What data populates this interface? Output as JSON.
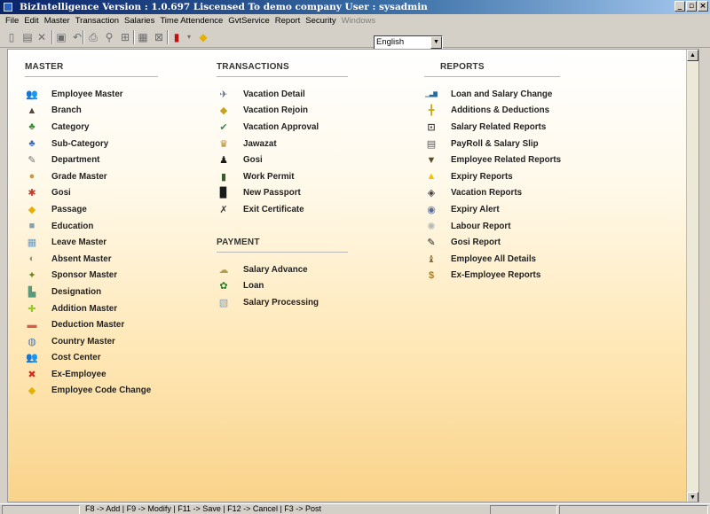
{
  "window": {
    "title": "BizIntelligence Version : 1.0.697   Liscensed To demo company  User : sysadmin",
    "buttons": {
      "minimize": "_",
      "restore": "▫",
      "close": "×"
    }
  },
  "menu": [
    {
      "label": "File",
      "enabled": true
    },
    {
      "label": "Edit",
      "enabled": true
    },
    {
      "label": "Master",
      "enabled": true
    },
    {
      "label": "Transaction",
      "enabled": true
    },
    {
      "label": "Salaries",
      "enabled": true
    },
    {
      "label": "Time Attendence",
      "enabled": true
    },
    {
      "label": "GvtService",
      "enabled": true
    },
    {
      "label": "Report",
      "enabled": true
    },
    {
      "label": "Security",
      "enabled": true
    },
    {
      "label": "Windows",
      "enabled": false
    }
  ],
  "toolbar": {
    "buttons": [
      {
        "name": "new-document-icon",
        "glyph": "▯"
      },
      {
        "name": "open-folder-icon",
        "glyph": "▤"
      },
      {
        "name": "delete-x-icon",
        "glyph": "✕"
      },
      {
        "name": "save-disk-icon",
        "glyph": "▣"
      },
      {
        "name": "undo-icon",
        "glyph": "↶"
      },
      {
        "name": "print-icon",
        "glyph": "⎙"
      },
      {
        "name": "find-binoculars-icon",
        "glyph": "⚲"
      },
      {
        "name": "filter-icon",
        "glyph": "⊞"
      },
      {
        "name": "preview-icon",
        "glyph": "▦"
      },
      {
        "name": "cancel-edit-icon",
        "glyph": "⊠"
      },
      {
        "name": "exit-door-icon",
        "glyph": "▮"
      },
      {
        "name": "help-icon",
        "glyph": "◆"
      }
    ],
    "language": {
      "selected": "English"
    }
  },
  "sections": {
    "master": {
      "title": "MASTER",
      "items": [
        {
          "label": "Employee Master",
          "icon": "employees-icon",
          "glyph": "👥",
          "color": "#c89a2a"
        },
        {
          "label": "Branch",
          "icon": "branch-icon",
          "glyph": "▲",
          "color": "#5a4a3a"
        },
        {
          "label": "Category",
          "icon": "category-icon",
          "glyph": "♣",
          "color": "#3c8a3c"
        },
        {
          "label": "Sub-Category",
          "icon": "sub-category-icon",
          "glyph": "♣",
          "color": "#3a6ebf"
        },
        {
          "label": "Department",
          "icon": "department-icon",
          "glyph": "✎",
          "color": "#707070"
        },
        {
          "label": "Grade Master",
          "icon": "grade-icon",
          "glyph": "●",
          "color": "#c99a3a"
        },
        {
          "label": "Gosi",
          "icon": "gosi-icon",
          "glyph": "✱",
          "color": "#c23a2a"
        },
        {
          "label": "Passage",
          "icon": "passage-icon",
          "glyph": "◆",
          "color": "#e5b000"
        },
        {
          "label": "Education",
          "icon": "education-icon",
          "glyph": "■",
          "color": "#8aa0a8"
        },
        {
          "label": "Leave Master",
          "icon": "leave-icon",
          "glyph": "▦",
          "color": "#6a9ac0"
        },
        {
          "label": "Absent Master",
          "icon": "absent-icon",
          "glyph": "◐",
          "color": "#8a9a7a"
        },
        {
          "label": "Sponsor Master",
          "icon": "sponsor-icon",
          "glyph": "✦",
          "color": "#6a8a1a"
        },
        {
          "label": "Designation",
          "icon": "designation-icon",
          "glyph": "▙",
          "color": "#5a9a7a"
        },
        {
          "label": "Addition Master",
          "icon": "addition-icon",
          "glyph": "✚",
          "color": "#9ac832"
        },
        {
          "label": "Deduction Master",
          "icon": "deduction-icon",
          "glyph": "▬",
          "color": "#d85a4a"
        },
        {
          "label": "Country Master",
          "icon": "globe-icon",
          "glyph": "◍",
          "color": "#4a7ac0"
        },
        {
          "label": "Cost Center",
          "icon": "cost-center-icon",
          "glyph": "👥",
          "color": "#c89a2a"
        },
        {
          "label": "Ex-Employee",
          "icon": "ex-employee-icon",
          "glyph": "✖",
          "color": "#d42a1a"
        },
        {
          "label": "Employee Code Change",
          "icon": "code-change-icon",
          "glyph": "◆",
          "color": "#e5b000"
        }
      ]
    },
    "transactions": {
      "title": "TRANSACTIONS",
      "items": [
        {
          "label": "Vacation Detail",
          "icon": "vacation-detail-icon",
          "glyph": "✈",
          "color": "#5a6a8a"
        },
        {
          "label": "Vacation Rejoin",
          "icon": "vacation-rejoin-icon",
          "glyph": "◆",
          "color": "#c8a41a"
        },
        {
          "label": "Vacation Approval",
          "icon": "vacation-approval-icon",
          "glyph": "✔",
          "color": "#3a8a4a"
        },
        {
          "label": "Jawazat",
          "icon": "jawazat-icon",
          "glyph": "♛",
          "color": "#b08a2a"
        },
        {
          "label": "Gosi",
          "icon": "gosi-person-icon",
          "glyph": "♟",
          "color": "#1a1a1a"
        },
        {
          "label": "Work Permit",
          "icon": "work-permit-icon",
          "glyph": "▮",
          "color": "#3a5a2a"
        },
        {
          "label": "New Passport",
          "icon": "passport-icon",
          "glyph": "▉",
          "color": "#1a1a1a"
        },
        {
          "label": "Exit Certificate",
          "icon": "exit-certificate-icon",
          "glyph": "✗",
          "color": "#404040"
        }
      ]
    },
    "payment": {
      "title": "PAYMENT",
      "items": [
        {
          "label": "Salary Advance",
          "icon": "salary-advance-icon",
          "glyph": "☁",
          "color": "#b0a050"
        },
        {
          "label": "Loan",
          "icon": "loan-icon",
          "glyph": "✿",
          "color": "#2a7a2a"
        },
        {
          "label": "Salary Processing",
          "icon": "salary-processing-icon",
          "glyph": "▧",
          "color": "#8aa0b8"
        }
      ]
    },
    "reports": {
      "title": "REPORTS",
      "items": [
        {
          "label": "Loan and Salary Change",
          "icon": "bar-chart-icon",
          "glyph": "▁▃▇",
          "color": "#2a6a9a"
        },
        {
          "label": "Additions & Deductions",
          "icon": "additions-deductions-icon",
          "glyph": "╋",
          "color": "#c8a41a"
        },
        {
          "label": "Salary Related Reports",
          "icon": "line-chart-icon",
          "glyph": "⊡",
          "color": "#404040"
        },
        {
          "label": "PayRoll & Salary Slip",
          "icon": "payslip-icon",
          "glyph": "▤",
          "color": "#5a5a5a"
        },
        {
          "label": "Employee Related Reports",
          "icon": "employee-report-icon",
          "glyph": "▼",
          "color": "#5a4a2a"
        },
        {
          "label": "Expiry Reports",
          "icon": "warning-icon",
          "glyph": "▲",
          "color": "#f2c200"
        },
        {
          "label": "Vacation Reports",
          "icon": "vacation-report-icon",
          "glyph": "◈",
          "color": "#404040"
        },
        {
          "label": "Expiry Alert",
          "icon": "alert-icon",
          "glyph": "◉",
          "color": "#5a6a9a"
        },
        {
          "label": "Labour Report",
          "icon": "labour-report-icon",
          "glyph": "✺",
          "color": "#b8b8b8"
        },
        {
          "label": "Gosi Report",
          "icon": "gosi-report-icon",
          "glyph": "✎",
          "color": "#1a1a1a"
        },
        {
          "label": "Employee All Details",
          "icon": "employee-details-icon",
          "glyph": "♝",
          "color": "#8a6a3a"
        },
        {
          "label": "Ex-Employee Reports",
          "icon": "ex-employee-report-icon",
          "glyph": "$",
          "color": "#b07a1a"
        }
      ]
    }
  },
  "status": {
    "shortcuts": "F8 -> Add  |  F9 -> Modify  |  F11 -> Save  |  F12 -> Cancel  |  F3 -> Post"
  }
}
